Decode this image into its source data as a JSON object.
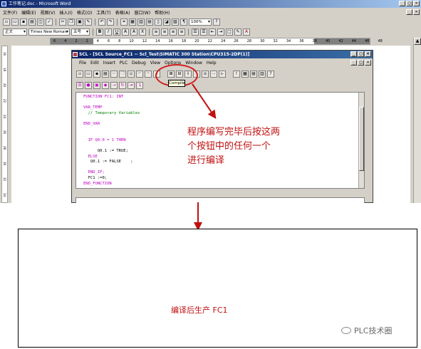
{
  "word": {
    "title": "工作笔记.doc - Microsoft Word",
    "menu": [
      "文件(F)",
      "编辑(E)",
      "视图(V)",
      "插入(I)",
      "格式(O)",
      "工具(T)",
      "表格(A)",
      "窗口(W)",
      "帮助(H)"
    ],
    "style_combo": "正文",
    "font_combo": "Times New Roman",
    "size_combo": "五号",
    "zoom": "100%",
    "ruler_numbers": [
      "6",
      "4",
      "2",
      "2",
      "4",
      "6",
      "8",
      "10",
      "12",
      "14",
      "16",
      "18",
      "20",
      "22",
      "24",
      "26",
      "28",
      "30",
      "32",
      "34",
      "36",
      "38",
      "40",
      "42",
      "44",
      "46",
      "48"
    ],
    "vruler_numbers": [
      "16",
      "18",
      "20",
      "22",
      "24",
      "26",
      "28",
      "30",
      "32",
      "34"
    ]
  },
  "scl": {
    "title": "SCL - [SCL Source_FC1 -- Scl_Test\\SIMATIC 300 Station\\CPU315-2DP(1)]",
    "menu": [
      "File",
      "Edit",
      "Insert",
      "PLC",
      "Debug",
      "View",
      "Options",
      "Window",
      "Help"
    ],
    "tooltip": "Compile",
    "code": [
      {
        "text": "FUNCTION FC1: INT",
        "cls": "kw"
      },
      {
        "text": "",
        "cls": "id"
      },
      {
        "text": "VAR_TEMP",
        "cls": "kw"
      },
      {
        "text": "  // Temporary Variables",
        "cls": "cm"
      },
      {
        "text": "",
        "cls": "id"
      },
      {
        "text": "END_VAR",
        "cls": "kw"
      },
      {
        "text": "",
        "cls": "id"
      },
      {
        "text": "",
        "cls": "id"
      },
      {
        "text": "  IF Q0.0 = 1 THEN",
        "cls": "kw"
      },
      {
        "text": "",
        "cls": "id"
      },
      {
        "text": "      Q0.1 := TRUE;",
        "cls": "id"
      },
      {
        "text": "  ELSE",
        "cls": "kw"
      },
      {
        "text": "   Q0.1 := FALSE    ;",
        "cls": "id"
      },
      {
        "text": "",
        "cls": "id"
      },
      {
        "text": "  END_IF;",
        "cls": "kw"
      },
      {
        "text": "  FC1 :=0;",
        "cls": "id"
      },
      {
        "text": "END_FUNCTION",
        "cls": "kw"
      }
    ]
  },
  "annotation": [
    "程序编写完毕后按这两",
    "个按钮中的任何一个",
    "进行编译"
  ],
  "result": "编译后生产 FC1",
  "watermark": "PLC技术圈"
}
